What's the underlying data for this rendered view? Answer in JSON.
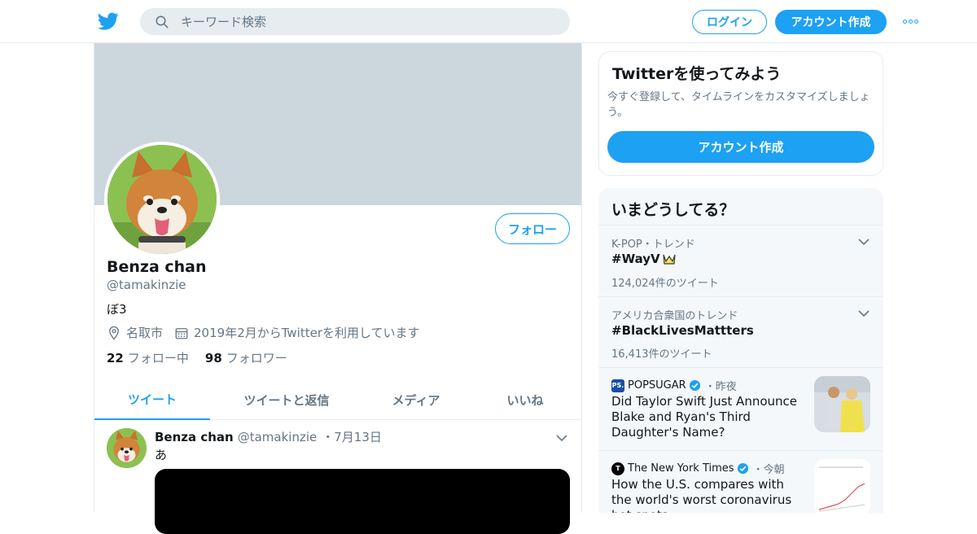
{
  "header": {
    "search_placeholder": "キーワード検索",
    "login_label": "ログイン",
    "signup_label": "アカウント作成"
  },
  "profile": {
    "name": "Benza chan",
    "handle": "@tamakinzie",
    "bio": "ぼ3",
    "location": "名取市",
    "joined": "2019年2月からTwitterを利用しています",
    "following_count": "22",
    "following_label": "フォロー中",
    "followers_count": "98",
    "followers_label": "フォロワー",
    "follow_label": "フォロー"
  },
  "tabs": [
    {
      "label": "ツイート",
      "active": true
    },
    {
      "label": "ツイートと返信",
      "active": false
    },
    {
      "label": "メディア",
      "active": false
    },
    {
      "label": "いいね",
      "active": false
    }
  ],
  "tweet": {
    "name": "Benza chan",
    "handle": "@tamakinzie",
    "sep": "・",
    "date": "7月13日",
    "text": "あ"
  },
  "signup_box": {
    "title": "Twitterを使ってみよう",
    "description": "今すぐ登録して、タイムラインをカスタマイズしましょう。",
    "cta": "アカウント作成"
  },
  "trends": {
    "title": "いまどうしてる？",
    "items": [
      {
        "category": "K-POP・トレンド",
        "tag": "#WayV",
        "count": "124,024件のツイート"
      },
      {
        "category": "アメリカ合衆国のトレンド",
        "tag": "#BlackLivesMattters",
        "count": "16,413件のツイート"
      }
    ],
    "news": [
      {
        "source": "POPSUGAR",
        "source_icon": "PS.",
        "source_color": "#1b4fa0",
        "time": "・昨夜",
        "headline": "Did Taylor Swift Just Announce Blake and Ryan's Third Daughter's Name?"
      },
      {
        "source": "The New York Times",
        "source_icon": "T",
        "source_color": "#000000",
        "time": "・今朝",
        "headline": "How the U.S. compares with the world's worst coronavirus hot spots"
      }
    ]
  },
  "colors": {
    "accent": "#1da1f2",
    "banner": "#ccd6dd",
    "muted_text": "#657786"
  }
}
